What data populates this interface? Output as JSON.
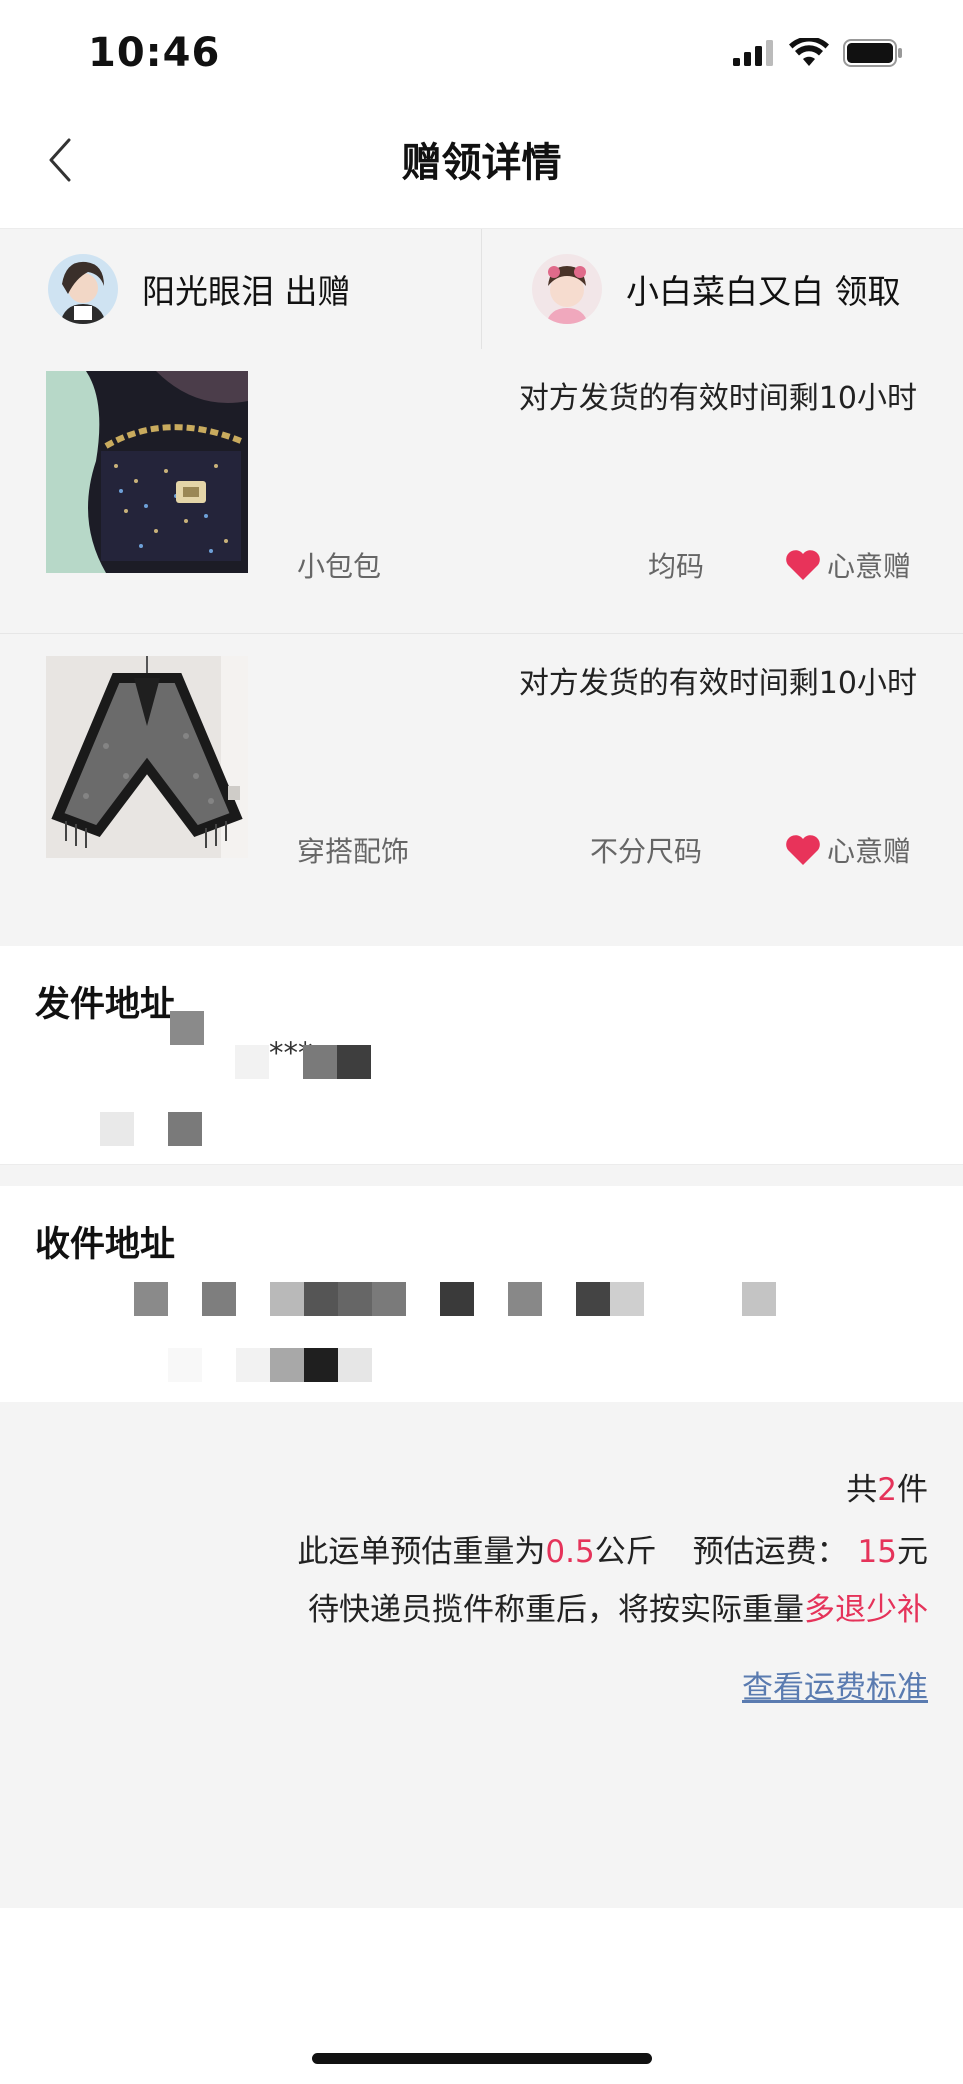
{
  "status_bar": {
    "time": "10:46"
  },
  "nav": {
    "title": "赠领详情"
  },
  "giver": {
    "label": "阳光眼泪 出赠"
  },
  "receiver": {
    "label": "小白菜白又白 领取"
  },
  "items": [
    {
      "deadline": "对方发货的有效时间剩10小时",
      "category": "小包包",
      "size": "均码",
      "gift_type": "心意赠"
    },
    {
      "deadline": "对方发货的有效时间剩10小时",
      "category": "穿搭配饰",
      "size": "不分尺码",
      "gift_type": "心意赠"
    }
  ],
  "sender_address": {
    "title": "发件地址",
    "line1_visible": "***"
  },
  "receiver_address": {
    "title": "收件地址"
  },
  "summary": {
    "total_prefix": "共",
    "total_count": "2",
    "total_suffix": "件",
    "weight_prefix": "此运单预估重量为",
    "weight_value": "0.5",
    "weight_unit": "公斤",
    "fee_label": "预估运费：",
    "fee_value": "15",
    "fee_unit": "元",
    "note_prefix": "待快递员揽件称重后，将按实际重量",
    "note_highlight": "多退少补",
    "link": "查看运费标准"
  },
  "colors": {
    "accent": "#e5335a",
    "link": "#5a7bb0",
    "heart": "#e8335a"
  }
}
